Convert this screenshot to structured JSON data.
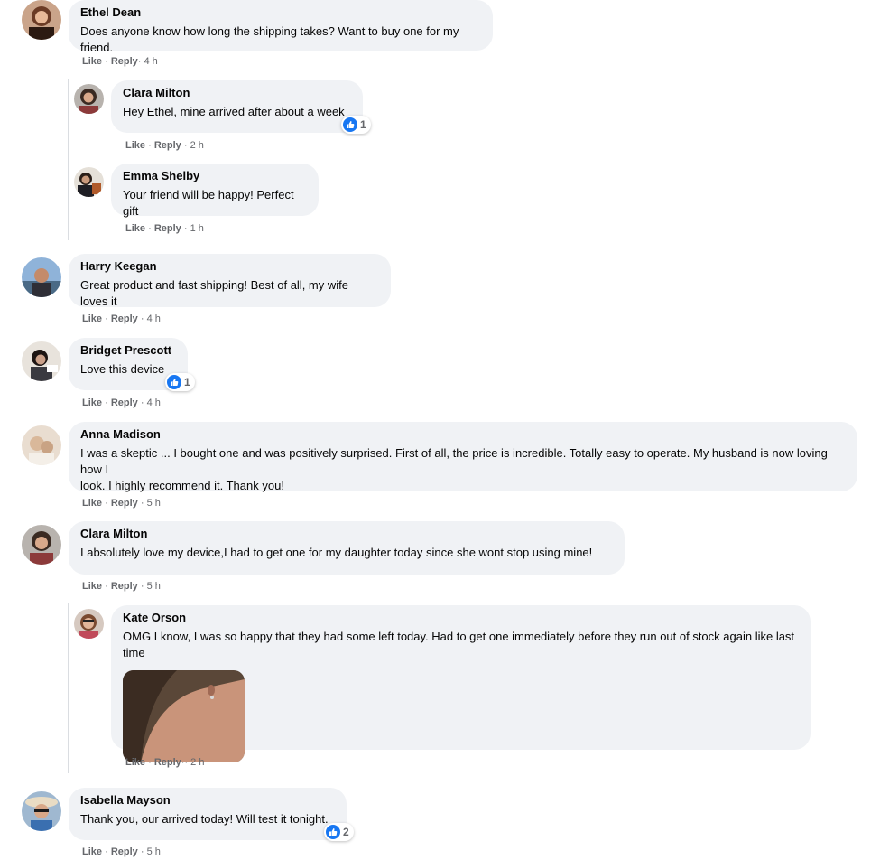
{
  "comments": [
    {
      "author": "Ethel Dean",
      "text": "Does anyone know how long the shipping takes? Want to buy one for my friend.",
      "like": "Like",
      "reply": "Reply",
      "time": "· 4 h"
    },
    {
      "author": "Clara Milton",
      "text": "Hey Ethel, mine arrived after about a week",
      "like": "Like",
      "reply": "Reply",
      "time": "· 2 h",
      "reactions": "1"
    },
    {
      "author": "Emma Shelby",
      "text": "Your friend will be happy! Perfect gift",
      "like": "Like",
      "reply": "Reply",
      "time": "· 1 h"
    },
    {
      "author": "Harry Keegan",
      "text": "Great product and fast shipping! Best of all, my wife loves it",
      "like": "Like",
      "reply": "Reply",
      "time": "· 4 h"
    },
    {
      "author": "Bridget Prescott",
      "text": "Love this device",
      "like": "Like",
      "reply": "Reply",
      "time": "· 4 h",
      "reactions": "1"
    },
    {
      "author": "Anna Madison",
      "text_line1": "I was a skeptic ... I bought one and was positively surprised. First of all, the price is incredible. Totally easy to operate. My husband is now loving how I",
      "text_line2": "look. I highly recommend it. Thank you!",
      "like": "Like",
      "reply": "Reply",
      "time": "· 5 h"
    },
    {
      "author": "Clara Milton",
      "text": "I absolutely love my device,I had to get one for my daughter today since she wont stop using mine!",
      "like": "Like",
      "reply": "Reply",
      "time": "· 5 h"
    },
    {
      "author": "Kate Orson",
      "text": "OMG I know, I was so happy that they had some left today. Had to get one immediately before they run out of stock again like last time",
      "like": "Like",
      "reply": "Reply",
      "time": "·· 2 h"
    },
    {
      "author": "Isabella Mayson",
      "text": "Thank you, our arrived today! Will test it tonight.",
      "like": "Like",
      "reply": "Reply",
      "time": "· 5 h",
      "reactions": "2"
    }
  ],
  "separator": "·",
  "colors": {
    "bubble": "#f0f2f5",
    "like_blue": "#1877f2",
    "meta_gray": "#65676b"
  },
  "icons": {
    "reaction": "thumbs-up-icon"
  }
}
